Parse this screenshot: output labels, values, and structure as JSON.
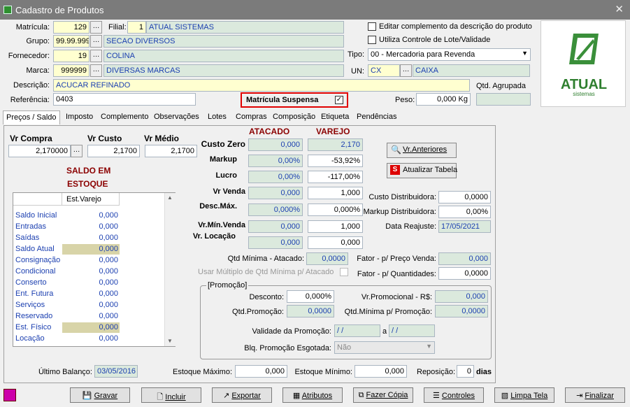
{
  "window": {
    "title": "Cadastro de Produtos"
  },
  "header": {
    "matricula_label": "Matrícula:",
    "matricula": "129",
    "filial_label": "Filial:",
    "filial_code": "1",
    "filial_name": "ATUAL SISTEMAS",
    "grupo_label": "Grupo:",
    "grupo_code": "99.99.999",
    "grupo_name": "SECAO DIVERSOS",
    "fornecedor_label": "Fornecedor:",
    "fornecedor_code": "19",
    "fornecedor_name": "COLINA",
    "marca_label": "Marca:",
    "marca_code": "999999",
    "marca_name": "DIVERSAS MARCAS",
    "descricao_label": "Descrição:",
    "descricao": "ACUCAR REFINADO",
    "referencia_label": "Referência:",
    "referencia": "0403",
    "suspensa_label": "Matrícula Suspensa",
    "peso_label": "Peso:",
    "peso": "0,000 Kg",
    "qtd_agrupada_label": "Qtd. Agrupada",
    "chk_complemento": "Editar complemento da descrição do produto",
    "chk_lote": "Utiliza Controle de Lote/Validade",
    "tipo_label": "Tipo:",
    "tipo": "00 - Mercadoria para Revenda",
    "un_label": "UN:",
    "un_code": "CX",
    "un_name": "CAIXA",
    "logo_text": "ATUAL",
    "logo_sub": "sistemas"
  },
  "tabs": [
    "Preços / Saldo",
    "Imposto",
    "Complemento",
    "Observações",
    "Lotes",
    "Compras",
    "Composição",
    "Etiqueta",
    "Pendências"
  ],
  "precos": {
    "vr_compra_label": "Vr Compra",
    "vr_compra": "2,170000",
    "vr_custo_label": "Vr Custo",
    "vr_custo": "2,1700",
    "vr_medio_label": "Vr Médio",
    "vr_medio": "2,1700",
    "saldo_title_1": "SALDO EM",
    "saldo_title_2": "ESTOQUE",
    "atacado": "ATACADO",
    "varejo": "VAREJO",
    "custo_zero_label": "Custo Zero",
    "custo_zero_atac": "0,000",
    "custo_zero_var": "2,170",
    "markup_label": "Markup",
    "markup_atac": "0,00%",
    "markup_var": "-53,92%",
    "lucro_label": "Lucro",
    "lucro_atac": "0,00%",
    "lucro_var": "-117,00%",
    "vr_venda_label": "Vr Venda",
    "vr_venda_atac": "0,000",
    "vr_venda_var": "1,000",
    "desc_max_label": "Desc.Máx.",
    "desc_max_atac": "0,000%",
    "desc_max_var": "0,000%",
    "vr_min_label": "Vr.Mín.Venda",
    "vr_min_atac": "0,000",
    "vr_min_var": "1,000",
    "vr_loc_label": "Vr. Locação",
    "vr_loc_atac": "0,000",
    "vr_loc_var": "0,000",
    "btn_anteriores": "Vr.Anteriores",
    "btn_atualizar": "Atualizar Tabela",
    "custo_dist_label": "Custo Distribuidora:",
    "custo_dist": "0,0000",
    "markup_dist_label": "Markup Distribuidora:",
    "markup_dist": "0,00%",
    "data_reajuste_label": "Data Reajuste:",
    "data_reajuste": "17/05/2021",
    "qtd_min_atac_label": "Qtd Mínima - Atacado:",
    "qtd_min_atac": "0,0000",
    "usar_multiplo_label": "Usar Múltiplo de Qtd Mínima p/ Atacado",
    "fator_preco_label": "Fator - p/ Preço Venda:",
    "fator_preco": "0,000",
    "fator_qtd_label": "Fator - p/ Quantidades:",
    "fator_qtd": "0,0000",
    "promo_group": "[Promoção]",
    "desconto_label": "Desconto:",
    "desconto": "0,000%",
    "vr_promo_label": "Vr.Promocional - R$:",
    "vr_promo": "0,000",
    "qtd_promo_label": "Qtd.Promoção:",
    "qtd_promo": "0,0000",
    "qtd_min_promo_label": "Qtd.Mínima p/ Promoção:",
    "qtd_min_promo": "0,0000",
    "validade_label": "Validade da Promoção:",
    "validade_de": " /  /",
    "validade_a_label": "a",
    "validade_ate": " /  /",
    "blq_label": "Blq. Promoção Esgotada:",
    "blq": "Não",
    "ultimo_balanco_label": "Último Balanço:",
    "ultimo_balanco": "03/05/2016",
    "est_max_label": "Estoque Máximo:",
    "est_max": "0,000",
    "est_min_label": "Estoque Mínimo:",
    "est_min": "0,000",
    "reposicao_label": "Reposição:",
    "reposicao": "0",
    "dias_label": "dias"
  },
  "saldo_list": {
    "header": "Est.Varejo",
    "rows": [
      {
        "label": "Saldo Inicial",
        "value": "0,000"
      },
      {
        "label": "Entradas",
        "value": "0,000"
      },
      {
        "label": "Saídas",
        "value": "0,000"
      },
      {
        "label": "Saldo Atual",
        "value": "0,000"
      },
      {
        "label": "Consignação",
        "value": "0,000"
      },
      {
        "label": "Condicional",
        "value": "0,000"
      },
      {
        "label": "Conserto",
        "value": "0,000"
      },
      {
        "label": "Ent. Futura",
        "value": "0,000"
      },
      {
        "label": "Serviços",
        "value": "0,000"
      },
      {
        "label": "Reservado",
        "value": "0,000"
      },
      {
        "label": "Est. Físico",
        "value": "0,000"
      },
      {
        "label": "Locação",
        "value": "0,000"
      }
    ]
  },
  "toolbar": {
    "gravar": "Gravar",
    "incluir": "Incluir",
    "exportar": "Exportar",
    "atributos": "Atributos",
    "fazer_copia": "Fazer Cópia",
    "controles": "Controles",
    "limpa_tela": "Limpa Tela",
    "finalizar": "Finalizar"
  }
}
